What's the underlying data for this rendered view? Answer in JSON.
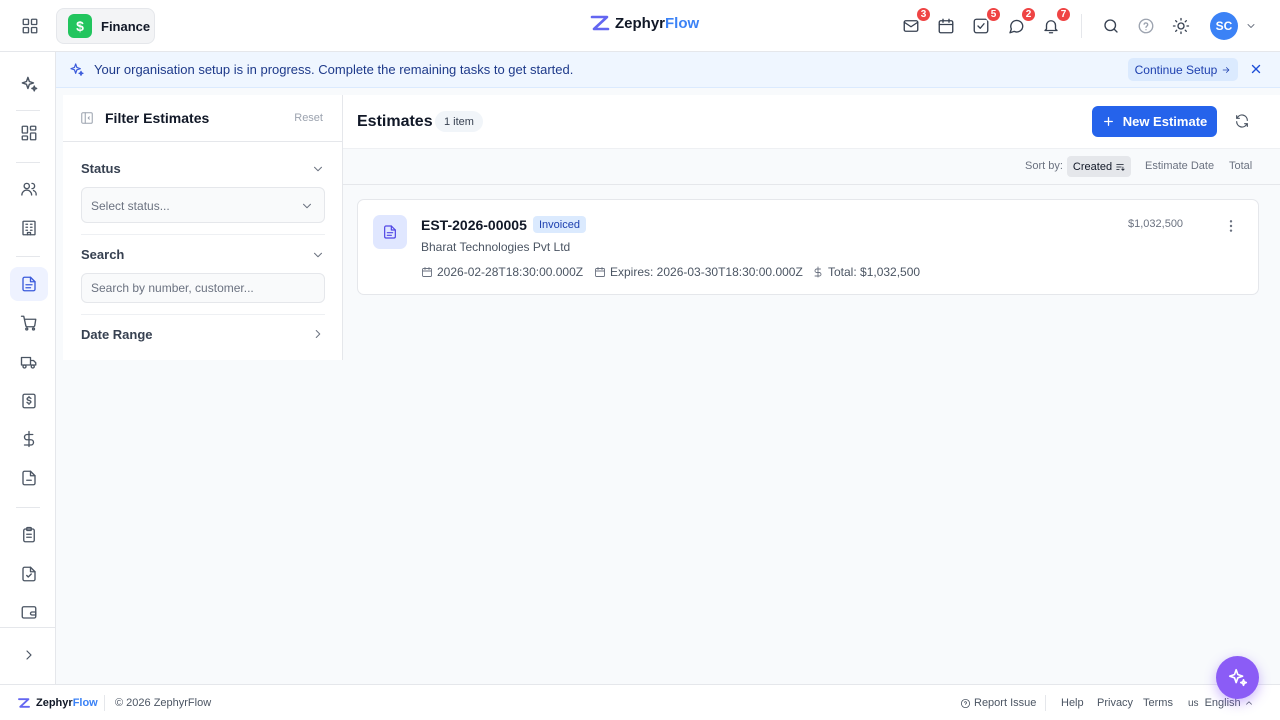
{
  "header": {
    "app_name": "Finance",
    "app_icon_glyph": "$",
    "brand_part1": "Zephyr",
    "brand_part2": "Flow",
    "mail_count": "3",
    "tasks_count": "5",
    "chat_count": "2",
    "notifications_count": "7",
    "user_initials": "SC"
  },
  "banner": {
    "message": "Your organisation setup is in progress. Complete the remaining tasks to get started.",
    "action_label": "Continue Setup"
  },
  "filter": {
    "title": "Filter Estimates",
    "reset_label": "Reset",
    "status_label": "Status",
    "status_placeholder": "Select status...",
    "search_label": "Search",
    "search_placeholder": "Search by number, customer...",
    "date_range_label": "Date Range"
  },
  "main": {
    "title": "Estimates",
    "count_label": "1 item",
    "new_button_label": "New Estimate",
    "sort_label": "Sort by:",
    "sort_options": [
      "Created",
      "Estimate Date",
      "Total"
    ],
    "active_sort": "Created"
  },
  "estimates": [
    {
      "number": "EST-2026-00005",
      "status": "Invoiced",
      "customer": "Bharat Technologies Pvt Ltd",
      "date": "2026-02-28T18:30:00.000Z",
      "expires": "Expires: 2026-03-30T18:30:00.000Z",
      "total": "Total: $1,032,500",
      "amount": "$1,032,500"
    }
  ],
  "footer": {
    "brand_part1": "Zephyr",
    "brand_part2": "Flow",
    "copyright": "© 2026 ZephyrFlow",
    "report_issue": "Report Issue",
    "help": "Help",
    "privacy": "Privacy",
    "terms": "Terms",
    "language_code": "us",
    "language": "English"
  },
  "colors": {
    "primary": "#2563eb",
    "finance_green": "#22c55e",
    "badge_red": "#ef4444",
    "assistant_purple": "#8b5cf6"
  }
}
